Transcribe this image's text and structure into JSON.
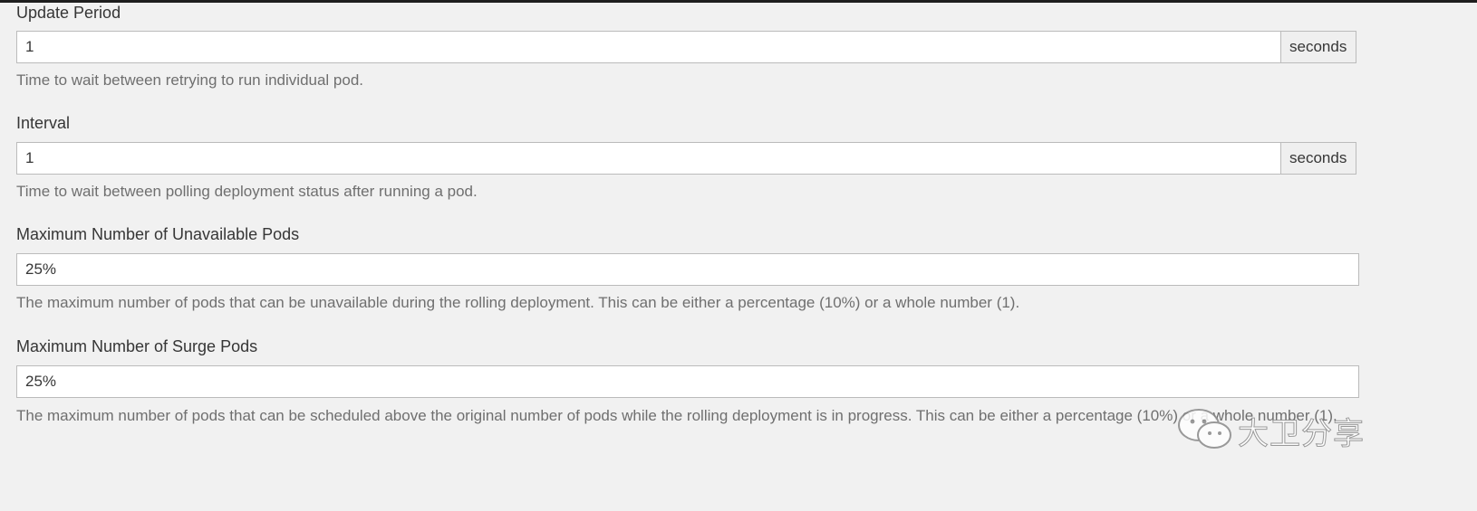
{
  "fields": [
    {
      "label": "Update Period",
      "value": "1",
      "addon": "seconds",
      "help": "Time to wait between retrying to run individual pod."
    },
    {
      "label": "Interval",
      "value": "1",
      "addon": "seconds",
      "help": "Time to wait between polling deployment status after running a pod."
    },
    {
      "label": "Maximum Number of Unavailable Pods",
      "value": "25%",
      "help": "The maximum number of pods that can be unavailable during the rolling deployment. This can be either a percentage (10%) or a whole number (1)."
    },
    {
      "label": "Maximum Number of Surge Pods",
      "value": "25%",
      "help": "The maximum number of pods that can be scheduled above the original number of pods while the rolling deployment is in progress. This can be either a percentage (10%) or a whole number (1)."
    }
  ],
  "watermark": {
    "text": "大卫分享",
    "icon": "wechat-icon"
  }
}
